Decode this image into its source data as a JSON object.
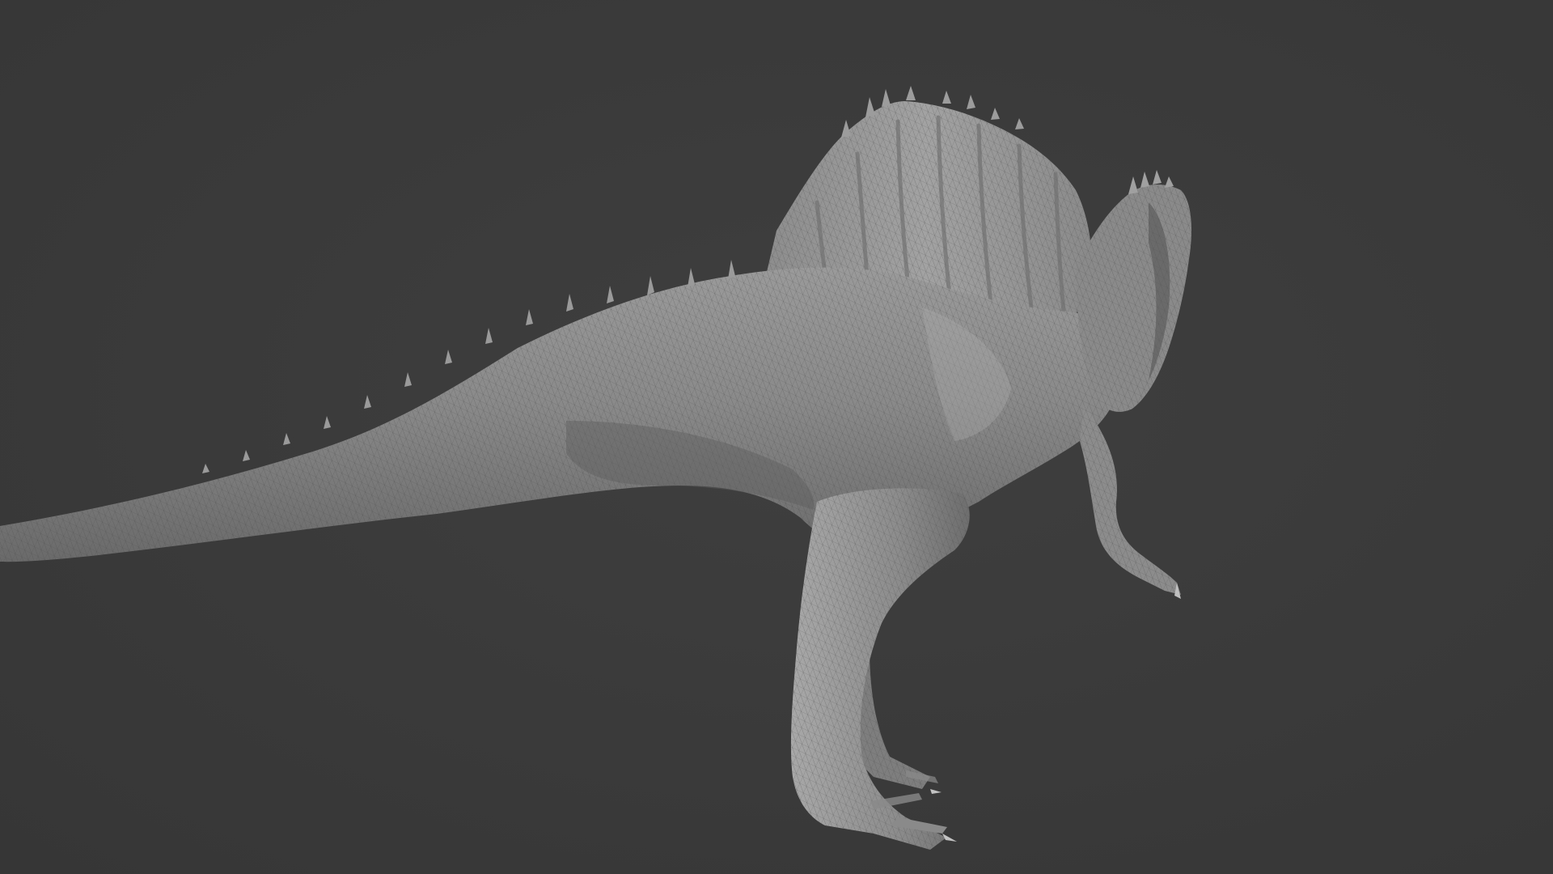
{
  "viewport": {
    "background_color": "#3a3a3a",
    "mesh_base_color": "#8e8e8e",
    "mesh_highlight_color": "#b8b8b8",
    "mesh_shadow_color": "#5a5a5a",
    "wire_color": "#4a4a4a",
    "display_mode": "wireframe-on-shaded",
    "subject": "spinosaurus-sculpt"
  }
}
